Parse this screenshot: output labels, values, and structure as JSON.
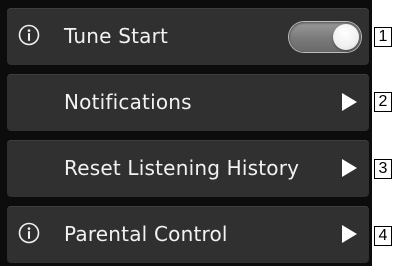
{
  "menu": {
    "items": [
      {
        "label": "Tune Start",
        "icon": "info-icon",
        "control": "toggle",
        "toggle_on": true,
        "callout": "1"
      },
      {
        "label": "Notifications",
        "icon": "",
        "control": "chevron-right-icon",
        "callout": "2"
      },
      {
        "label": "Reset Listening History",
        "icon": "",
        "control": "chevron-right-icon",
        "callout": "3"
      },
      {
        "label": "Parental Control",
        "icon": "info-icon",
        "control": "chevron-right-icon",
        "callout": "4"
      }
    ]
  },
  "colors": {
    "panel_background": "#0c0c0c",
    "row_background": "#303030",
    "text": "#f2f2f2",
    "toggle_track": "#7a7a7a",
    "toggle_knob": "#ffffff"
  }
}
